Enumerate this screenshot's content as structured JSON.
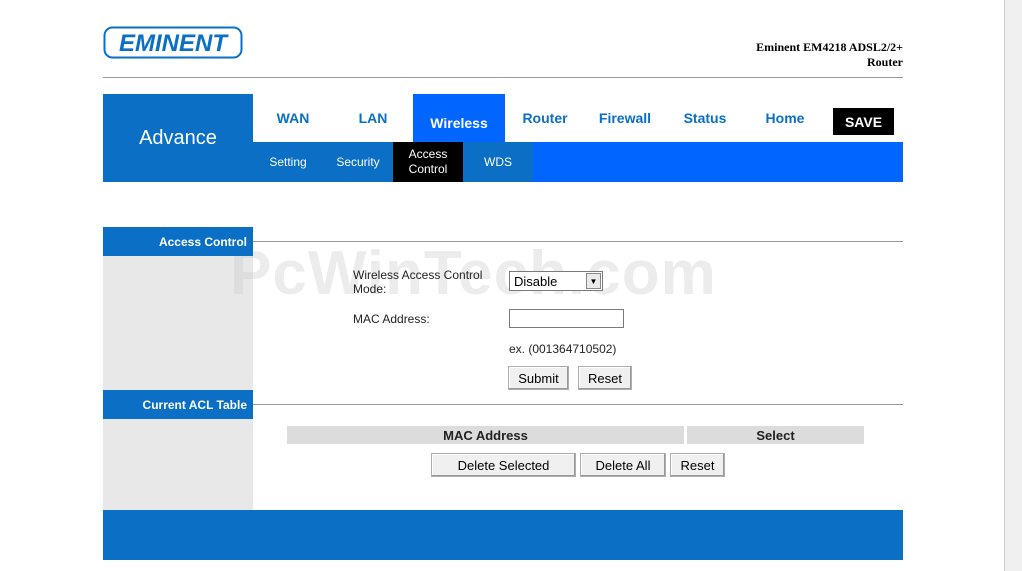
{
  "header": {
    "logo_text": "EMINENT",
    "product_line1": "Eminent EM4218 ADSL2/2+",
    "product_line2": "Router"
  },
  "nav": {
    "section_title": "Advance",
    "tabs": [
      {
        "label": "WAN"
      },
      {
        "label": "LAN"
      },
      {
        "label": "Wireless",
        "active": true
      },
      {
        "label": "Router"
      },
      {
        "label": "Firewall"
      },
      {
        "label": "Status"
      },
      {
        "label": "Home"
      }
    ],
    "save_label": "SAVE",
    "subtabs": [
      {
        "label": "Setting"
      },
      {
        "label": "Security"
      },
      {
        "label": "Access Control",
        "active": true
      },
      {
        "label": "WDS"
      }
    ]
  },
  "access_control": {
    "heading": "Access Control",
    "mode_label": "Wireless Access Control Mode:",
    "mode_value": "Disable",
    "mac_label": "MAC Address:",
    "mac_value": "",
    "example": "ex. (001364710502)",
    "submit_label": "Submit",
    "reset_label": "Reset"
  },
  "acl_table": {
    "heading": "Current ACL Table",
    "columns": [
      "MAC Address",
      "Select"
    ],
    "delete_selected_label": "Delete Selected",
    "delete_all_label": "Delete All",
    "reset_label": "Reset"
  },
  "watermark": "PcWinTech.com",
  "colors": {
    "brand_blue": "#0a6fc5",
    "active_blue": "#0066ff",
    "save_black": "#000000"
  }
}
